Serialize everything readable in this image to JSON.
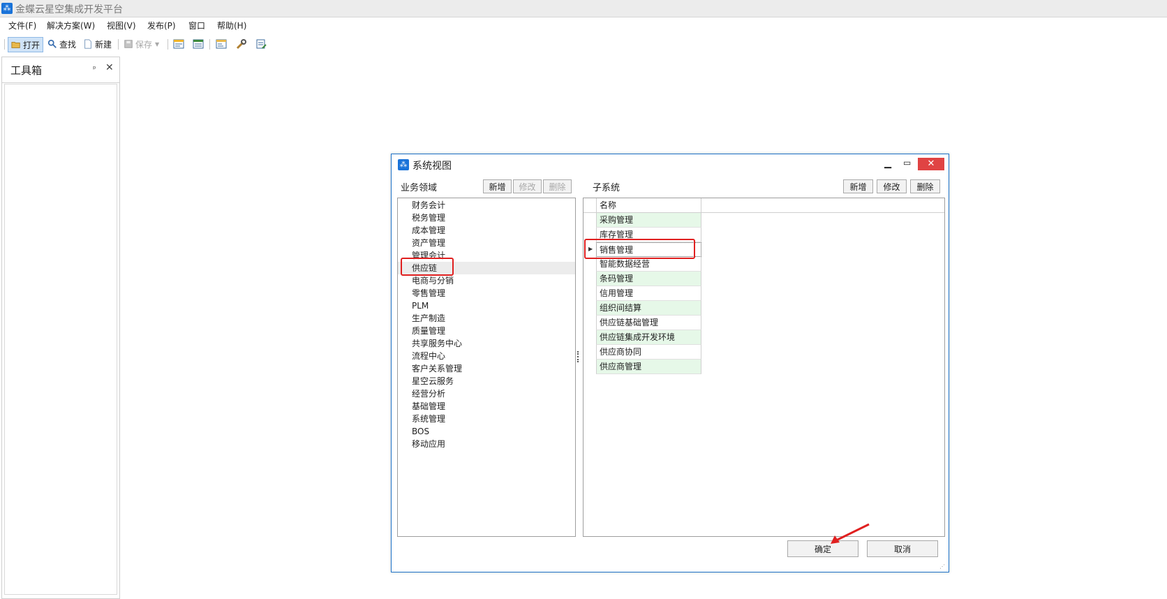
{
  "app": {
    "title": "金蝶云星空集成开发平台",
    "icon": "app-logo-icon"
  },
  "menu": [
    "文件(F)",
    "解决方案(W)",
    "视图(V)",
    "发布(P)",
    "窗口",
    "帮助(H)"
  ],
  "toolbar": {
    "open": "打开",
    "find": "查找",
    "new": "新建",
    "save": "保存"
  },
  "toolbox": {
    "title": "工具箱",
    "pin": "ᵖ",
    "close": "✕"
  },
  "dialog": {
    "title": "系统视图",
    "left_label": "业务领域",
    "right_label": "子系统",
    "left_buttons": {
      "add": "新增",
      "edit": "修改",
      "delete": "删除"
    },
    "right_buttons": {
      "add": "新增",
      "edit": "修改",
      "delete": "删除"
    },
    "domains": [
      "财务会计",
      "税务管理",
      "成本管理",
      "资产管理",
      "管理会计",
      "供应链",
      "电商与分销",
      "零售管理",
      "PLM",
      "生产制造",
      "质量管理",
      "共享服务中心",
      "流程中心",
      "客户关系管理",
      "星空云服务",
      "经营分析",
      "基础管理",
      "系统管理",
      "BOS",
      "移动应用"
    ],
    "selected_domain": "供应链",
    "grid_header": "名称",
    "subsystems": [
      "采购管理",
      "库存管理",
      "销售管理",
      "智能数据经营",
      "条码管理",
      "信用管理",
      "组织间结算",
      "供应链基础管理",
      "供应链集成开发环境",
      "供应商协同",
      "供应商管理"
    ],
    "selected_subsystem": "销售管理",
    "ok": "确定",
    "cancel": "取消"
  },
  "colors": {
    "accent": "#1a73d9",
    "highlight": "#e02020",
    "row_green": "#e6f8e8",
    "close_red": "#e04343"
  }
}
